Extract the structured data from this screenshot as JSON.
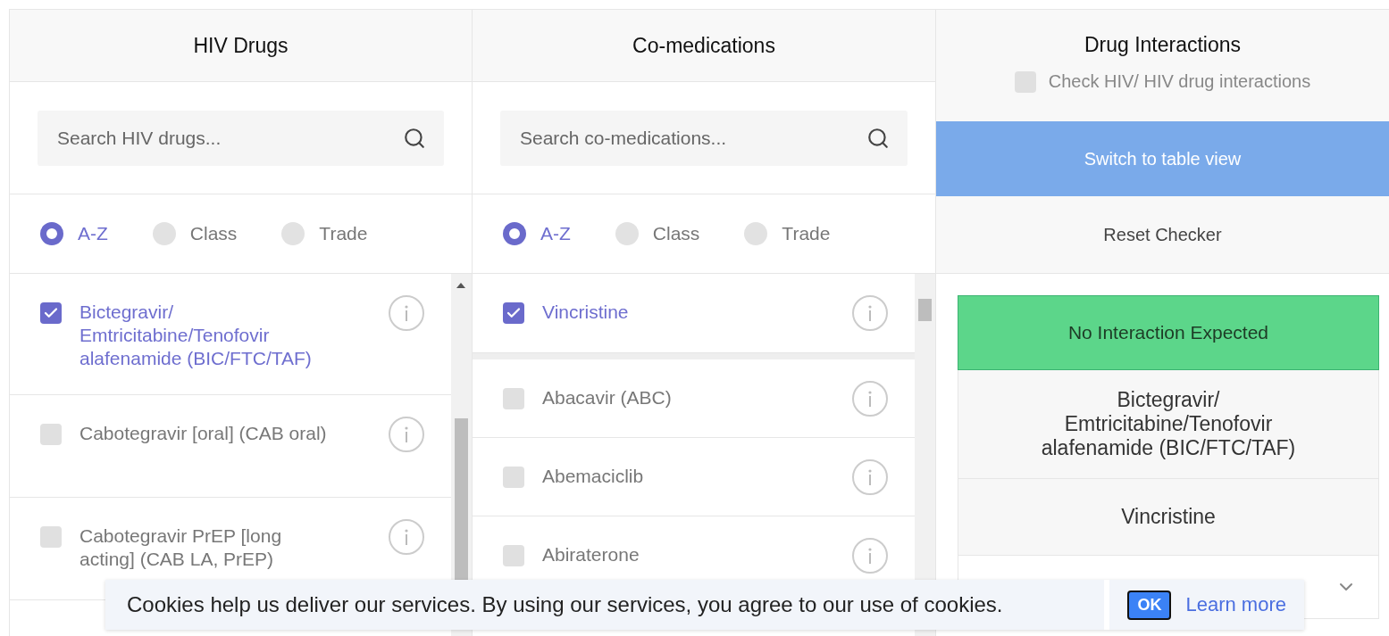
{
  "columns": [
    {
      "title": "HIV Drugs",
      "search": {
        "placeholder": "Search HIV drugs..."
      },
      "sort_options": [
        {
          "label": "A-Z",
          "selected": true
        },
        {
          "label": "Class",
          "selected": false
        },
        {
          "label": "Trade",
          "selected": false
        }
      ],
      "items": [
        {
          "name": "Bictegravir/ Emtricitabine/Tenofovir alafenamide (BIC/FTC/TAF)",
          "checked": true
        },
        {
          "name": "Cabotegravir [oral] (CAB oral)",
          "checked": false
        },
        {
          "name": "Cabotegravir PrEP [long acting] (CAB LA, PrEP)",
          "checked": false
        }
      ]
    },
    {
      "title": "Co-medications",
      "search": {
        "placeholder": "Search co-medications..."
      },
      "sort_options": [
        {
          "label": "A-Z",
          "selected": true
        },
        {
          "label": "Class",
          "selected": false
        },
        {
          "label": "Trade",
          "selected": false
        }
      ],
      "pinned": [
        {
          "name": "Vincristine",
          "checked": true
        }
      ],
      "items": [
        {
          "name": "Abacavir (ABC)",
          "checked": false
        },
        {
          "name": "Abemaciclib",
          "checked": false
        },
        {
          "name": "Abiraterone",
          "checked": false
        }
      ]
    }
  ],
  "interactions": {
    "title": "Drug Interactions",
    "hiv_check": {
      "label": "Check HIV/ HIV drug interactions",
      "checked": false
    },
    "switch_button": "Switch to table view",
    "reset_button": "Reset Checker",
    "result": {
      "status": "No Interaction Expected",
      "color": "#5cd68a",
      "drugs": [
        "Bictegravir/ Emtricitabine/Tenofovir alafenamide (BIC/FTC/TAF)",
        "Vincristine"
      ]
    }
  },
  "cookie_banner": {
    "message": "Cookies help us deliver our services. By using our services, you agree to our use of cookies.",
    "ok": "OK",
    "link": "Learn more"
  }
}
